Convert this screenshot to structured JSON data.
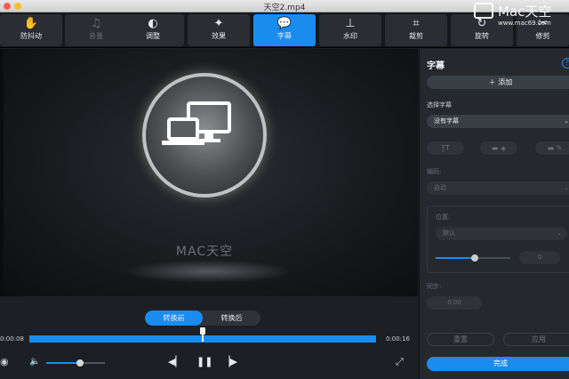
{
  "window": {
    "title": "天空2.mp4"
  },
  "toolbar": {
    "tools": [
      {
        "label": "防抖动",
        "icon": "hand-icon"
      },
      {
        "label": "音量",
        "icon": "music-note-icon"
      },
      {
        "label": "调整",
        "icon": "contrast-icon"
      },
      {
        "label": "效果",
        "icon": "magic-wand-icon"
      },
      {
        "label": "字幕",
        "icon": "speech-bubble-icon"
      },
      {
        "label": "水印",
        "icon": "stamp-icon"
      },
      {
        "label": "裁剪",
        "icon": "crop-icon"
      },
      {
        "label": "旋转",
        "icon": "rotate-icon"
      },
      {
        "label": "修剪",
        "icon": "scissors-icon"
      }
    ],
    "active_index": 4
  },
  "video": {
    "brand_text": "MAC天空"
  },
  "compare": {
    "before": "转换前",
    "after": "转换后"
  },
  "timeline": {
    "current": "0:00:08",
    "total": "0:00:16",
    "progress": 0.5
  },
  "volume": {
    "level": 0.58
  },
  "panel": {
    "title": "字幕",
    "add_label": "添加",
    "select_subtitle_label": "选择字幕",
    "subtitle_value": "没有字幕",
    "encoding_label": "编码:",
    "encoding_value": "自动",
    "position_label": "位置:",
    "position_value": "默认",
    "offset_value": "0",
    "sync_label": "同步:",
    "sync_value": "0.00",
    "reset_label": "重置",
    "apply_label": "应用",
    "done_label": "完成"
  },
  "watermark": {
    "text": "Mac天空",
    "url": "www.mac69.com"
  }
}
